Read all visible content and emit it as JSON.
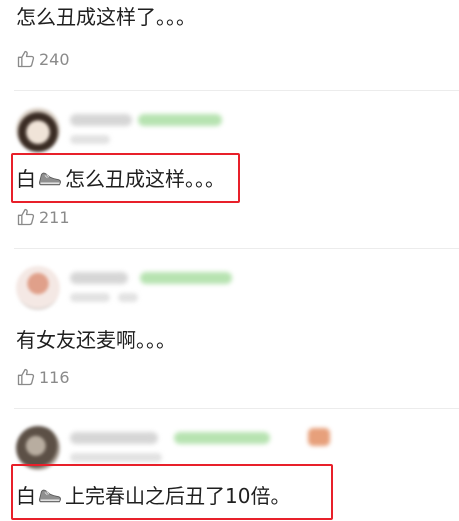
{
  "comments": [
    {
      "text": "怎么丑成这样了。。。",
      "likes": "240"
    },
    {
      "text_before": "白",
      "icon": "sneaker-icon",
      "text_after": "怎么丑成这样。。。",
      "likes": "211",
      "highlight_color": "#e8202a"
    },
    {
      "text": "有女友还麦啊。。。",
      "likes": "116"
    },
    {
      "text_before": "白",
      "icon": "sneaker-icon",
      "text_after": "上完春山之后丑了10倍。",
      "highlight_color": "#e8202a"
    }
  ],
  "colors": {
    "text": "#1f1f1f",
    "like_gray": "#8a8a8a",
    "highlight_red": "#e8202a",
    "blurred_badge_green": "#b7e3b1"
  }
}
